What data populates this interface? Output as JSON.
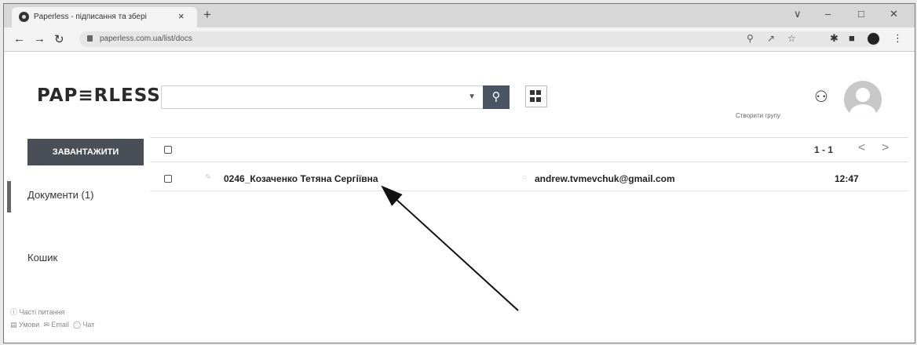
{
  "browser": {
    "tab_title": "Paperless - підписання та збері",
    "tab_close": "×",
    "new_tab": "+",
    "url": "paperless.com.ua/list/docs",
    "window_controls": [
      "∨",
      "–",
      "□",
      "✕"
    ],
    "icons": [
      "back-icon",
      "forward-icon",
      "reload-icon",
      "key-icon",
      "share-icon",
      "star-icon",
      "extensions-icon",
      "sidepanel-icon",
      "profile-icon",
      "menu-icon"
    ]
  },
  "app": {
    "logo": "PAP≡RLESS",
    "search": {
      "value": "",
      "placeholder": ""
    },
    "group_label": "Створити групу"
  },
  "sidebar": {
    "upload_label": "ЗАВАНТАЖИТИ",
    "items": [
      {
        "label": "Документи (1)",
        "active": true
      },
      {
        "label": "Кошик",
        "active": false
      }
    ],
    "footer": {
      "faq": "Часті питання",
      "links": [
        "Умови",
        "Email",
        "Чат"
      ]
    }
  },
  "list": {
    "pagination": "1 - 1",
    "prev": "<",
    "next": ">",
    "rows": [
      {
        "name": "0246_Козаченко Тетяна Сергіївна",
        "email": "andrew.tvmevchuk@gmail.com",
        "time": "12:47"
      }
    ]
  },
  "colors": {
    "accent_dark": "#4a4f57",
    "search_button": "#4a5563"
  }
}
